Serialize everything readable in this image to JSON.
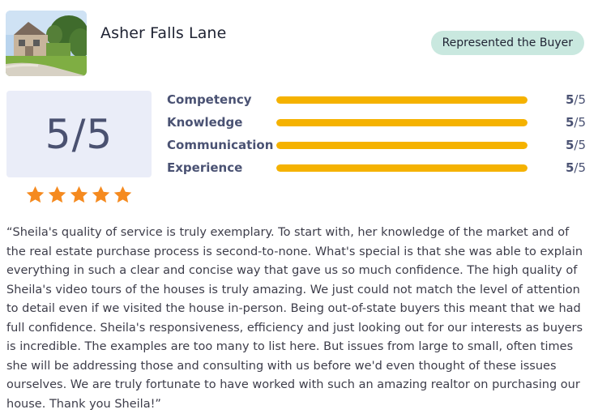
{
  "listing": {
    "title": "Asher Falls Lane",
    "badge": "Represented the Buyer"
  },
  "rating": {
    "overall": "5/5",
    "stars": 5,
    "star_color": "#f58a1f",
    "categories": [
      {
        "label": "Competency",
        "score": "5",
        "max": "/5",
        "fraction": 1.0
      },
      {
        "label": "Knowledge",
        "score": "5",
        "max": "/5",
        "fraction": 1.0
      },
      {
        "label": "Communication",
        "score": "5",
        "max": "/5",
        "fraction": 1.0
      },
      {
        "label": "Experience",
        "score": "5",
        "max": "/5",
        "fraction": 1.0
      }
    ],
    "bar_color": "#f5b200"
  },
  "review": {
    "text": "“Sheila's quality of service is truly exemplary. To start with, her knowledge of the market and of the real estate purchase process is second-to-none. What's special is that she was able to explain everything in such a clear and concise way that gave us so much confidence. The high quality of Sheila's video tours of the houses is truly amazing. We just could not match the level of attention to detail even if we visited the house in-person. Being out-of-state buyers this meant that we had full confidence. Sheila's responsiveness, efficiency and just looking out for our interests as buyers is incredible. The examples are too many to list here. But issues from large to small, often times she will be addressing those and consulting with us before we'd even thought of these issues ourselves. We are truly fortunate to have worked with such an amazing realtor on purchasing our house. Thank you Sheila!”"
  },
  "colors": {
    "badge_bg": "#c9e8df",
    "score_box_bg": "#eaedf8",
    "label_text": "#4a5273"
  }
}
